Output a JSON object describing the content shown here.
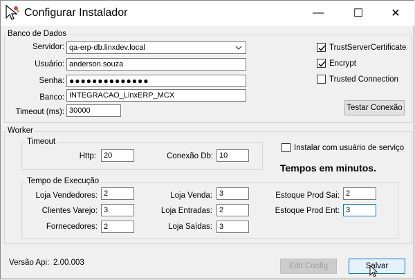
{
  "window": {
    "title": "Configurar Instalador",
    "controls": {
      "minimize": "—",
      "maximize": "☐",
      "close": "✕"
    }
  },
  "banco": {
    "group_label": "Banco de Dados",
    "servidor_label": "Servidor:",
    "servidor_value": "qa-erp-db.linxdev.local",
    "usuario_label": "Usuário:",
    "usuario_value": "anderson.souza",
    "senha_label": "Senha:",
    "senha_value": "●●●●●●●●●●●●●●",
    "banco_label": "Banco:",
    "banco_value": "INTEGRACAO_LinxERP_MCX",
    "timeout_label": "Timeout (ms):",
    "timeout_value": "30000",
    "trust_cert_label": "TrustServerCertificate",
    "trust_cert_checked": true,
    "encrypt_label": "Encrypt",
    "encrypt_checked": true,
    "trusted_conn_label": "Trusted Connection",
    "trusted_conn_checked": false,
    "test_button": "Testar Conexão"
  },
  "worker": {
    "group_label": "Worker",
    "timeout_group": "Timeout",
    "http_label": "Http:",
    "http_value": "20",
    "conexao_label": "Conexão Db:",
    "conexao_value": "10",
    "service_user_label": "Instalar com usuário de serviço",
    "service_user_checked": false,
    "minutes_note": "Tempos em minutos.",
    "exec_group": "Tempo de Execução",
    "loja_vendedores_label": "Loja Vendedores:",
    "loja_vendedores_value": "2",
    "clientes_varejo_label": "Clientes Varejo:",
    "clientes_varejo_value": "3",
    "fornecedores_label": "Fornecedores:",
    "fornecedores_value": "2",
    "loja_venda_label": "Loja Venda:",
    "loja_venda_value": "3",
    "loja_entradas_label": "Loja Entradas:",
    "loja_entradas_value": "2",
    "loja_saidas_label": "Loja Saídas:",
    "loja_saidas_value": "3",
    "estoque_sai_label": "Estoque Prod Sai:",
    "estoque_sai_value": "2",
    "estoque_ent_label": "Estoque Prod Ent:",
    "estoque_ent_value": "3"
  },
  "footer": {
    "versao_label": "Versão Api:",
    "versao_value": "2.00.003",
    "edit_button": "Edit Config",
    "save_button": "Salvar"
  }
}
